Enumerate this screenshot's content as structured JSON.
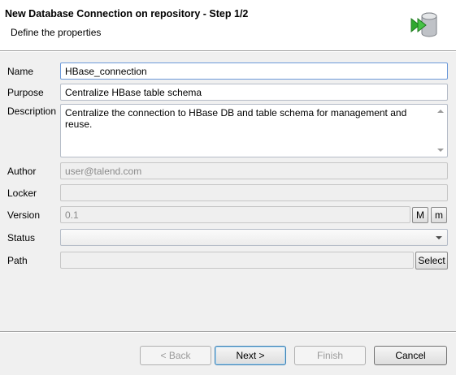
{
  "header": {
    "title": "New Database Connection on repository - Step 1/2",
    "subtitle": "Define the properties"
  },
  "form": {
    "name_label": "Name",
    "name_value": "HBase_connection",
    "purpose_label": "Purpose",
    "purpose_value": "Centralize HBase table schema",
    "description_label": "Description",
    "description_value": "Centralize the connection to HBase DB and table schema for management and reuse.",
    "author_label": "Author",
    "author_value": "user@talend.com",
    "locker_label": "Locker",
    "locker_value": "",
    "version_label": "Version",
    "version_value": "0.1",
    "version_major_btn": "M",
    "version_minor_btn": "m",
    "status_label": "Status",
    "status_value": "",
    "path_label": "Path",
    "path_value": "",
    "path_select_btn": "Select"
  },
  "footer": {
    "back": "< Back",
    "next": "Next >",
    "finish": "Finish",
    "cancel": "Cancel"
  },
  "icons": {
    "wizard": "database-connection-wizard-icon",
    "accent_green": "#2fa82f",
    "db_gray": "#b9bcc2"
  }
}
